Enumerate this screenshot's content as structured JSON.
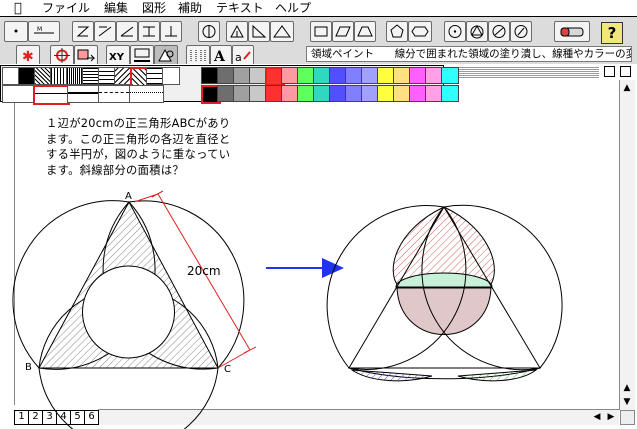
{
  "menu": {
    "items": [
      "ファイル",
      "編集",
      "図形",
      "補助",
      "テキスト",
      "ヘルプ"
    ]
  },
  "toolbar": {
    "status_title": "領域ペイント",
    "status_description": "線分で囲まれた領域の塗り潰し、線種やカラーの変更",
    "help_label": "?"
  },
  "palette": {
    "colors": [
      "#000000",
      "#6e6e6e",
      "#a0a0a0",
      "#c8c8c8",
      "#ff3030",
      "#ff9aa0",
      "#60ff60",
      "#30d8c0",
      "#5050ff",
      "#8080ff",
      "#a0a0ff",
      "#ffff40",
      "#ffe080",
      "#ff60ff",
      "#ffa0e8",
      "#30ffff"
    ]
  },
  "page_tabs": [
    "1",
    "2",
    "3",
    "4",
    "5",
    "6"
  ],
  "problem": {
    "lines": [
      "１辺が20cmの正三角形ABCがあり",
      "ます。この正三角形の各辺を直径と",
      "する半円が，図のように重なってい",
      "ます。斜線部分の面積は？"
    ]
  },
  "figure": {
    "vertex_a": "A",
    "vertex_b": "B",
    "vertex_c": "C",
    "side_length_label": "20cm"
  }
}
